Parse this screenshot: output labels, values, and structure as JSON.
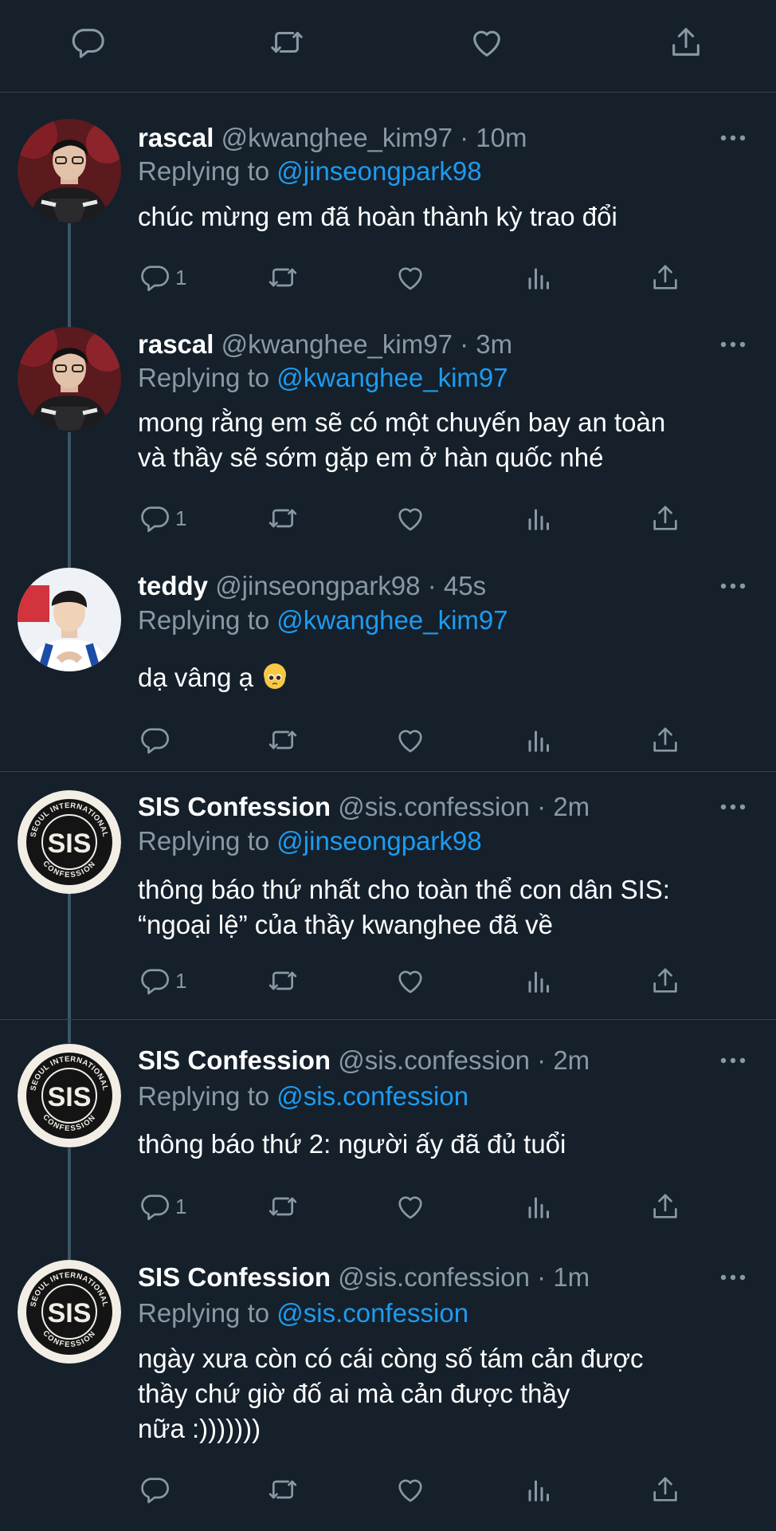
{
  "toolbar": {
    "icons": [
      "reply-icon",
      "retweet-icon",
      "like-icon",
      "share-icon"
    ]
  },
  "colors": {
    "background": "#15202b",
    "divider": "#38444d",
    "secondary_text": "#8899a6",
    "mention": "#1d9bf0"
  },
  "tweets": [
    {
      "name": "rascal",
      "handle": "@kwanghee_kim97",
      "time": "10m",
      "reply_prefix": "Replying to",
      "reply_to": "@jinseongpark98",
      "text": "chúc mừng em đã hoàn thành kỳ trao đổi",
      "reply_count": "1"
    },
    {
      "name": "rascal",
      "handle": "@kwanghee_kim97",
      "time": "3m",
      "reply_prefix": "Replying to",
      "reply_to": "@kwanghee_kim97",
      "text_line1": "mong rằng em sẽ có một chuyến bay an toàn",
      "text_line2": "và thầy sẽ sớm gặp em ở hàn quốc nhé",
      "reply_count": "1"
    },
    {
      "name": "teddy",
      "handle": "@jinseongpark98",
      "time": "45s",
      "reply_prefix": "Replying to",
      "reply_to": "@kwanghee_kim97",
      "text": "dạ vâng ạ",
      "emoji": "pleading-face-emoji",
      "reply_count": ""
    },
    {
      "name": "SIS Confession",
      "handle": "@sis.confession",
      "time": "2m",
      "reply_prefix": "Replying to",
      "reply_to": "@jinseongpark98",
      "text_line1": "thông báo thứ nhất cho toàn thể con dân SIS:",
      "text_line2": "“ngoại lệ” của thầy kwanghee đã về",
      "reply_count": "1"
    },
    {
      "name": "SIS Confession",
      "handle": "@sis.confession",
      "time": "2m",
      "reply_prefix": "Replying to",
      "reply_to": "@sis.confession",
      "text": "thông báo thứ 2: người ấy đã đủ tuổi",
      "reply_count": "1"
    },
    {
      "name": "SIS Confession",
      "handle": "@sis.confession",
      "time": "1m",
      "reply_prefix": "Replying to",
      "reply_to": "@sis.confession",
      "text_line1": "ngày xưa còn có cái còng số tám cản được",
      "text_line2": "thầy chứ giờ đố ai mà cản được thầy",
      "text_line3": "nữa :)))))))",
      "reply_count": ""
    }
  ],
  "sis_logo": {
    "center": "SIS",
    "ring_top": "SEOUL INTERNATIONAL",
    "ring_bottom": "CONFESSION"
  }
}
